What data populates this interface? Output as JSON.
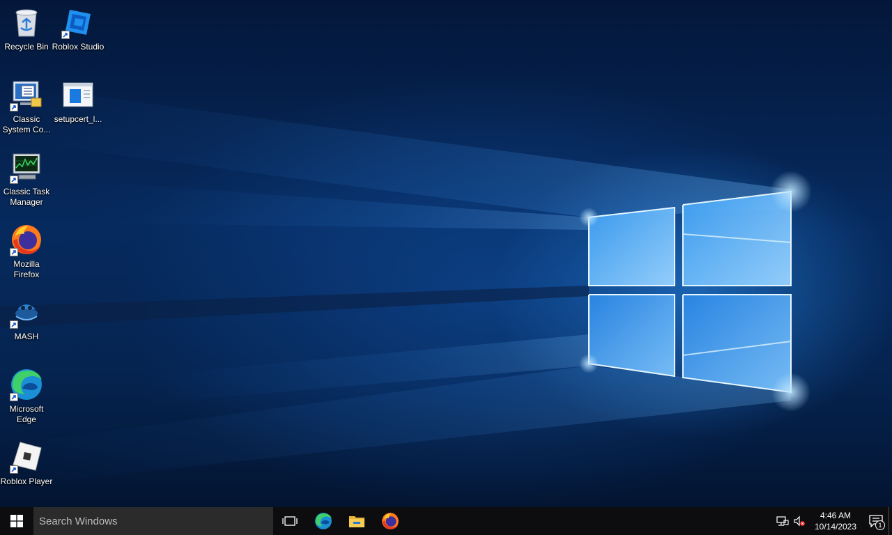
{
  "desktop": {
    "icons": [
      {
        "id": "recycle-bin",
        "label": "Recycle Bin"
      },
      {
        "id": "roblox-studio",
        "label": "Roblox Studio"
      },
      {
        "id": "classic-system-config",
        "label": "Classic System Co..."
      },
      {
        "id": "setupcert",
        "label": "setupcert_l..."
      },
      {
        "id": "classic-task-manager",
        "label": "Classic Task Manager"
      },
      {
        "id": "mozilla-firefox",
        "label": "Mozilla Firefox"
      },
      {
        "id": "mash",
        "label": "MASH"
      },
      {
        "id": "microsoft-edge",
        "label": "Microsoft Edge"
      },
      {
        "id": "roblox-player",
        "label": "Roblox Player"
      }
    ]
  },
  "taskbar": {
    "search_placeholder": "Search Windows",
    "pinned": [
      {
        "id": "task-view",
        "icon": "task-view-icon"
      },
      {
        "id": "edge",
        "icon": "edge-icon"
      },
      {
        "id": "file-explorer",
        "icon": "folder-icon"
      },
      {
        "id": "firefox",
        "icon": "firefox-icon"
      }
    ],
    "tray": {
      "network_icon": "network-icon",
      "volume_icon": "volume-muted-icon",
      "time": "4:46 AM",
      "date": "10/14/2023",
      "notification_count": "1"
    }
  },
  "colors": {
    "taskbar": "#0d0d10",
    "search_box": "#2b2b2b",
    "wallpaper_accent": "#2a8fe8"
  }
}
